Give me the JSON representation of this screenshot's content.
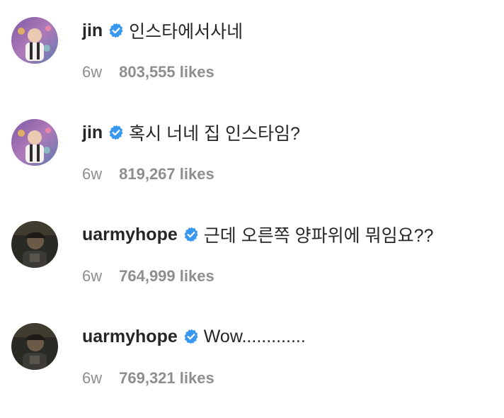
{
  "colors": {
    "username": "#262626",
    "text": "#262626",
    "meta": "#8e8e8e",
    "verified_badge": "#3897f0",
    "background": "#ffffff"
  },
  "icons": {
    "verified": "verified-badge-icon"
  },
  "comments": [
    {
      "username": "jin",
      "text": "인스타에서사네",
      "time": "6w",
      "likes": "803,555 likes",
      "verified": true
    },
    {
      "username": "jin",
      "text": "혹시 너네 집 인스타임?",
      "time": "6w",
      "likes": "819,267 likes",
      "verified": true
    },
    {
      "username": "uarmyhope",
      "text": "근데 오른쪽 양파위에 뭐임요??",
      "time": "6w",
      "likes": "764,999 likes",
      "verified": true
    },
    {
      "username": "uarmyhope",
      "text": "Wow.............",
      "time": "6w",
      "likes": "769,321 likes",
      "verified": true
    }
  ]
}
